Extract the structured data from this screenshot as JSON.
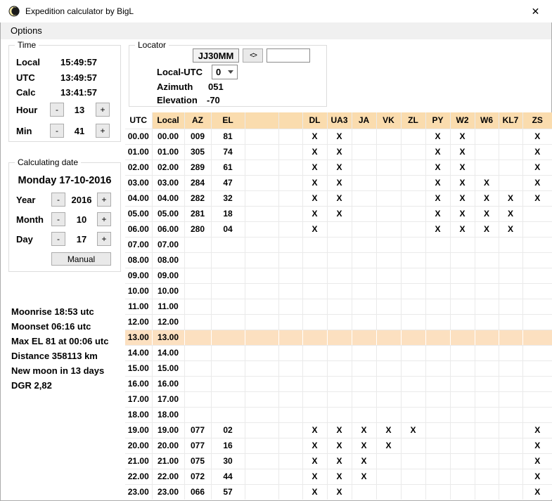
{
  "window": {
    "title": "Expedition calculator by BigL",
    "close_glyph": "✕"
  },
  "menu": {
    "items": [
      {
        "label": "Options"
      }
    ]
  },
  "controls": {
    "minus": "-",
    "plus": "+"
  },
  "time_box": {
    "title": "Time",
    "rows": [
      {
        "label": "Local",
        "value": "15:49:57"
      },
      {
        "label": "UTC",
        "value": "13:49:57"
      },
      {
        "label": "Calc",
        "value": "13:41:57"
      }
    ],
    "hour": {
      "label": "Hour",
      "value": "13"
    },
    "min": {
      "label": "Min",
      "value": "41"
    }
  },
  "locator_box": {
    "title": "Locator",
    "grid_value": "JJ30MM",
    "swap_label": "<>",
    "secondary_value": "",
    "local_utc_label": "Local-UTC",
    "local_utc_value": "0",
    "azimuth_label": "Azimuth",
    "azimuth_value": "051",
    "elevation_label": "Elevation",
    "elevation_value": "-70"
  },
  "date_box": {
    "title": "Calculating date",
    "date_display": "Monday 17-10-2016",
    "year": {
      "label": "Year",
      "value": "2016"
    },
    "month": {
      "label": "Month",
      "value": "10"
    },
    "day": {
      "label": "Day",
      "value": "17"
    },
    "manual_label": "Manual"
  },
  "moon_info": {
    "lines": [
      "Moonrise 18:53 utc",
      "Moonset 06:16 utc",
      "Max EL 81 at 00:06 utc",
      "Distance 358113 km",
      "New moon in 13 days",
      "DGR 2,82"
    ]
  },
  "table": {
    "columns": [
      "UTC",
      "Local",
      "AZ",
      "EL",
      "",
      "",
      "DL",
      "UA3",
      "JA",
      "VK",
      "ZL",
      "PY",
      "W2",
      "W6",
      "KL7",
      "ZS"
    ],
    "highlight_row": 13,
    "rows": [
      [
        "00.00",
        "00.00",
        "009",
        "81",
        "",
        "",
        "X",
        "X",
        "",
        "",
        "",
        "X",
        "X",
        "",
        "",
        "X"
      ],
      [
        "01.00",
        "01.00",
        "305",
        "74",
        "",
        "",
        "X",
        "X",
        "",
        "",
        "",
        "X",
        "X",
        "",
        "",
        "X"
      ],
      [
        "02.00",
        "02.00",
        "289",
        "61",
        "",
        "",
        "X",
        "X",
        "",
        "",
        "",
        "X",
        "X",
        "",
        "",
        "X"
      ],
      [
        "03.00",
        "03.00",
        "284",
        "47",
        "",
        "",
        "X",
        "X",
        "",
        "",
        "",
        "X",
        "X",
        "X",
        "",
        "X"
      ],
      [
        "04.00",
        "04.00",
        "282",
        "32",
        "",
        "",
        "X",
        "X",
        "",
        "",
        "",
        "X",
        "X",
        "X",
        "X",
        "X"
      ],
      [
        "05.00",
        "05.00",
        "281",
        "18",
        "",
        "",
        "X",
        "X",
        "",
        "",
        "",
        "X",
        "X",
        "X",
        "X",
        ""
      ],
      [
        "06.00",
        "06.00",
        "280",
        "04",
        "",
        "",
        "X",
        "",
        "",
        "",
        "",
        "X",
        "X",
        "X",
        "X",
        ""
      ],
      [
        "07.00",
        "07.00",
        "",
        "",
        "",
        "",
        "",
        "",
        "",
        "",
        "",
        "",
        "",
        "",
        "",
        ""
      ],
      [
        "08.00",
        "08.00",
        "",
        "",
        "",
        "",
        "",
        "",
        "",
        "",
        "",
        "",
        "",
        "",
        "",
        ""
      ],
      [
        "09.00",
        "09.00",
        "",
        "",
        "",
        "",
        "",
        "",
        "",
        "",
        "",
        "",
        "",
        "",
        "",
        ""
      ],
      [
        "10.00",
        "10.00",
        "",
        "",
        "",
        "",
        "",
        "",
        "",
        "",
        "",
        "",
        "",
        "",
        "",
        ""
      ],
      [
        "11.00",
        "11.00",
        "",
        "",
        "",
        "",
        "",
        "",
        "",
        "",
        "",
        "",
        "",
        "",
        "",
        ""
      ],
      [
        "12.00",
        "12.00",
        "",
        "",
        "",
        "",
        "",
        "",
        "",
        "",
        "",
        "",
        "",
        "",
        "",
        ""
      ],
      [
        "13.00",
        "13.00",
        "",
        "",
        "",
        "",
        "",
        "",
        "",
        "",
        "",
        "",
        "",
        "",
        "",
        ""
      ],
      [
        "14.00",
        "14.00",
        "",
        "",
        "",
        "",
        "",
        "",
        "",
        "",
        "",
        "",
        "",
        "",
        "",
        ""
      ],
      [
        "15.00",
        "15.00",
        "",
        "",
        "",
        "",
        "",
        "",
        "",
        "",
        "",
        "",
        "",
        "",
        "",
        ""
      ],
      [
        "16.00",
        "16.00",
        "",
        "",
        "",
        "",
        "",
        "",
        "",
        "",
        "",
        "",
        "",
        "",
        "",
        ""
      ],
      [
        "17.00",
        "17.00",
        "",
        "",
        "",
        "",
        "",
        "",
        "",
        "",
        "",
        "",
        "",
        "",
        "",
        ""
      ],
      [
        "18.00",
        "18.00",
        "",
        "",
        "",
        "",
        "",
        "",
        "",
        "",
        "",
        "",
        "",
        "",
        "",
        ""
      ],
      [
        "19.00",
        "19.00",
        "077",
        "02",
        "",
        "",
        "X",
        "X",
        "X",
        "X",
        "X",
        "",
        "",
        "",
        "",
        "X"
      ],
      [
        "20.00",
        "20.00",
        "077",
        "16",
        "",
        "",
        "X",
        "X",
        "X",
        "X",
        "",
        "",
        "",
        "",
        "",
        "X"
      ],
      [
        "21.00",
        "21.00",
        "075",
        "30",
        "",
        "",
        "X",
        "X",
        "X",
        "",
        "",
        "",
        "",
        "",
        "",
        "X"
      ],
      [
        "22.00",
        "22.00",
        "072",
        "44",
        "",
        "",
        "X",
        "X",
        "X",
        "",
        "",
        "",
        "",
        "",
        "",
        "X"
      ],
      [
        "23.00",
        "23.00",
        "066",
        "57",
        "",
        "",
        "X",
        "X",
        "",
        "",
        "",
        "",
        "",
        "",
        "",
        "X"
      ]
    ]
  },
  "colors": {
    "header_bg": "#FADCAE",
    "highlight_bg": "#FCE0C0",
    "grid_line": "#EAEAEA",
    "menubar_bg": "#F0F0F0"
  }
}
